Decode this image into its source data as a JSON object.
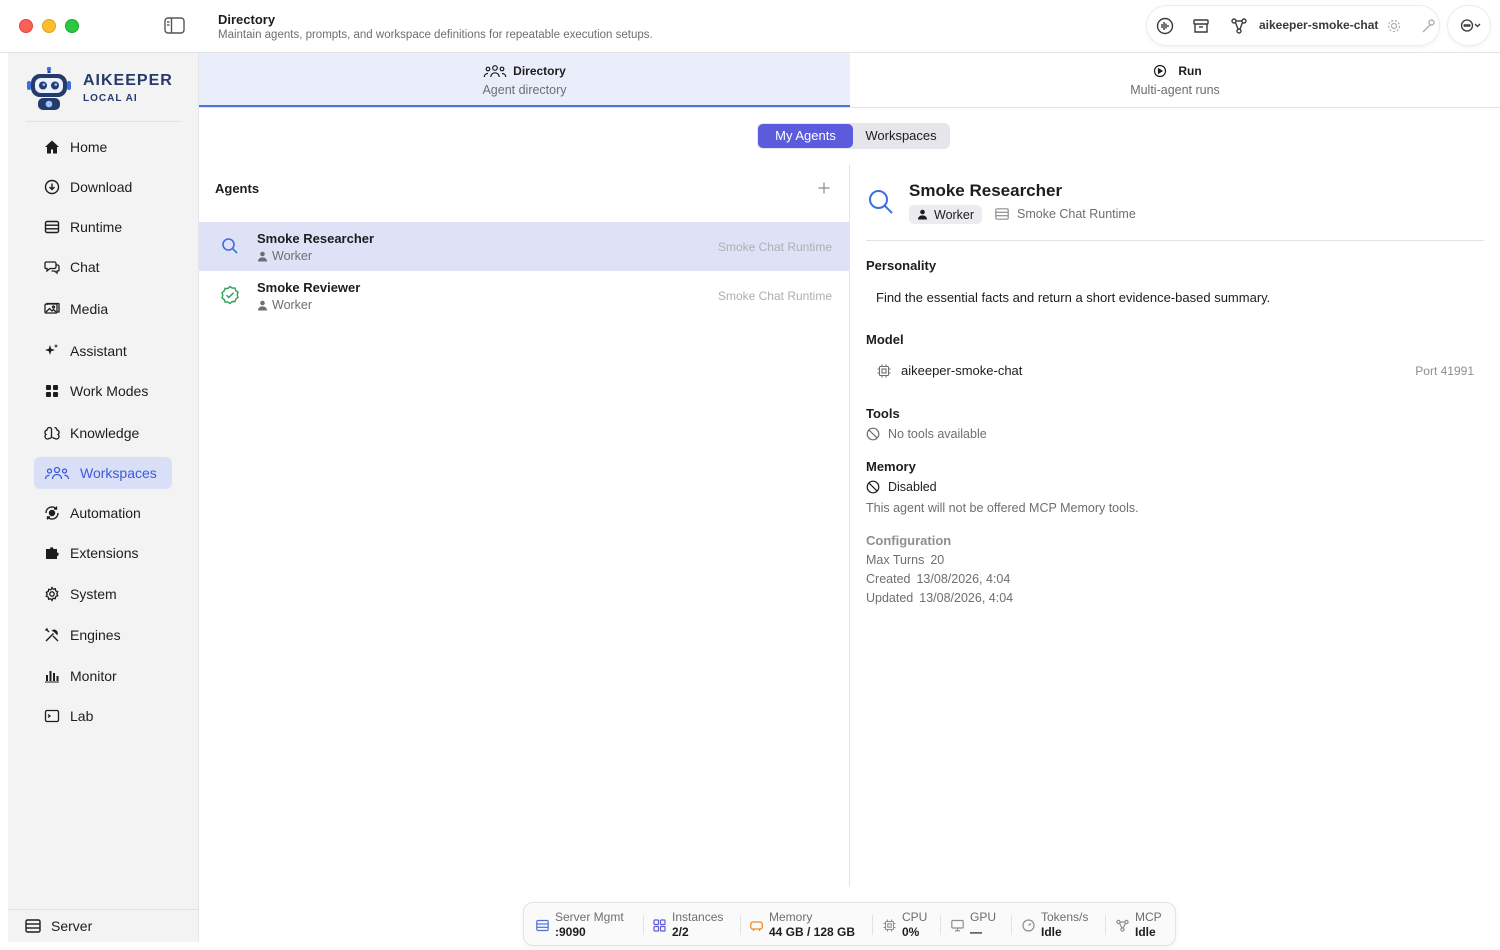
{
  "window": {
    "title": "Directory",
    "subtitle": "Maintain agents, prompts, and workspace definitions for repeatable execution setups."
  },
  "toolbar": {
    "model_name": "aikeeper-smoke-chat"
  },
  "brand": {
    "name": "AIKEEPER",
    "tagline": "LOCAL AI"
  },
  "sidebar": {
    "items": [
      {
        "label": "Home",
        "icon": "home-icon"
      },
      {
        "label": "Download",
        "icon": "download-icon"
      },
      {
        "label": "Runtime",
        "icon": "server-icon"
      },
      {
        "label": "Chat",
        "icon": "chat-icon"
      },
      {
        "label": "Media",
        "icon": "media-icon"
      },
      {
        "label": "Assistant",
        "icon": "sparkles-icon"
      },
      {
        "label": "Work Modes",
        "icon": "grid-icon"
      },
      {
        "label": "Knowledge",
        "icon": "brain-icon"
      },
      {
        "label": "Workspaces",
        "icon": "people-icon",
        "active": true
      },
      {
        "label": "Automation",
        "icon": "automation-icon"
      },
      {
        "label": "Extensions",
        "icon": "puzzle-icon"
      },
      {
        "label": "System",
        "icon": "gear-icon"
      },
      {
        "label": "Engines",
        "icon": "tools-icon"
      },
      {
        "label": "Monitor",
        "icon": "chart-bars-icon"
      },
      {
        "label": "Lab",
        "icon": "terminal-icon"
      }
    ],
    "footer_label": "Server"
  },
  "tabs": [
    {
      "label": "Directory",
      "sub": "Agent directory",
      "active": true
    },
    {
      "label": "Run",
      "sub": "Multi-agent runs",
      "active": false
    }
  ],
  "segmented": {
    "options": [
      "My Agents",
      "Workspaces"
    ],
    "selected": "My Agents"
  },
  "agents": {
    "title": "Agents",
    "list": [
      {
        "name": "Smoke Researcher",
        "role": "Worker",
        "runtime": "Smoke Chat Runtime",
        "icon": "search-icon",
        "selected": true
      },
      {
        "name": "Smoke Reviewer",
        "role": "Worker",
        "runtime": "Smoke Chat Runtime",
        "icon": "check-badge-icon",
        "selected": false
      }
    ]
  },
  "detail": {
    "name": "Smoke Researcher",
    "role": "Worker",
    "runtime": "Smoke Chat Runtime",
    "personality_title": "Personality",
    "personality": "Find the essential facts and return a short evidence-based summary.",
    "model_title": "Model",
    "model": "aikeeper-smoke-chat",
    "port": "Port 41991",
    "tools_title": "Tools",
    "tools": "No tools available",
    "memory_title": "Memory",
    "memory_state": "Disabled",
    "memory_note": "This agent will not be offered MCP Memory tools.",
    "config_title": "Configuration",
    "config": [
      {
        "label": "Max Turns",
        "value": "20"
      },
      {
        "label": "Created",
        "value": "13/08/2026, 4:04"
      },
      {
        "label": "Updated",
        "value": "13/08/2026, 4:04"
      }
    ]
  },
  "statusbar": [
    {
      "label": "Server Mgmt",
      "value": ":9090",
      "icon": "server-icon",
      "color": "#4a72d8"
    },
    {
      "label": "Instances",
      "value": "2/2",
      "icon": "grid-icon",
      "color": "#5b5bdb"
    },
    {
      "label": "Memory",
      "value": "44 GB / 128 GB",
      "icon": "memory-icon",
      "color": "#f08a24"
    },
    {
      "label": "CPU",
      "value": "0%",
      "icon": "cpu-icon",
      "color": "#8e8e93"
    },
    {
      "label": "GPU",
      "value": "—",
      "icon": "monitor-icon",
      "color": "#8e8e93"
    },
    {
      "label": "Tokens/s",
      "value": "Idle",
      "icon": "gauge-icon",
      "color": "#8e8e93"
    },
    {
      "label": "MCP",
      "value": "Idle",
      "icon": "network-icon",
      "color": "#8e8e93"
    }
  ]
}
